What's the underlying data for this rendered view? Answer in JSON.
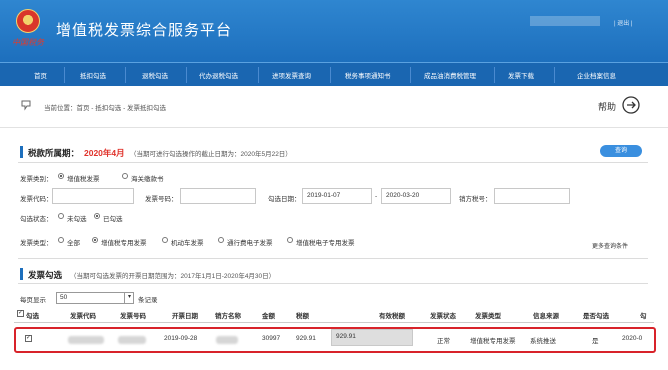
{
  "header": {
    "title": "增值税发票综合服务平台",
    "emblem_text": "中国税务",
    "exit_label": "| 退出 |"
  },
  "nav": {
    "items": [
      "首页",
      "抵扣勾选",
      "退税勾选",
      "代办退税勾选",
      "进项发票查询",
      "税务事项通知书",
      "成品油消费税管理",
      "发票下载",
      "企业档案信息"
    ]
  },
  "breadcrumb": {
    "text": "当前位置：首页 - 抵扣勾选 - 发票抵扣勾选",
    "help_label": "帮助"
  },
  "period": {
    "label": "税款所属期：",
    "value": "2020年4月",
    "note": "（当期可进行勾选操作的截止日期为：2020年5月22日）",
    "query_button": "查询"
  },
  "filters": {
    "invoice_class_label": "发票类别：",
    "invoice_class_options": [
      "增值税发票",
      "海关缴款书"
    ],
    "invoice_code_label": "发票代码：",
    "invoice_number_label": "发票号码：",
    "date_label": "勾选日期：",
    "date_from": "2019-01-07",
    "date_sep": "-",
    "date_to": "2020-03-20",
    "seller_tax_label": "销方税号：",
    "check_status_label": "勾选状态：",
    "check_status_options": [
      "未勾选",
      "已勾选"
    ],
    "invoice_type_label": "发票类型：",
    "invoice_type_options": [
      "全部",
      "增值税专用发票",
      "机动车发票",
      "通行费电子发票",
      "增值税电子专用发票"
    ],
    "more_conditions": "更多查询条件"
  },
  "invoice_section": {
    "title": "发票勾选",
    "note": "（当期可勾选发票的开票日期范围为：2017年1月1日-2020年4月30日）",
    "page_size_label": "每页显示",
    "page_size_value": "50",
    "page_size_unit": "条记录"
  },
  "table": {
    "headers": [
      "勾选",
      "发票代码",
      "发票号码",
      "开票日期",
      "销方名称",
      "金额",
      "税额",
      "有效税额",
      "发票状态",
      "发票类型",
      "信息来源",
      "是否勾选",
      "勾"
    ],
    "row": {
      "date": "2019-09-28",
      "amount": "30997",
      "tax": "929.91",
      "valid_tax": "929.91",
      "status": "正常",
      "type": "增值税专用发票",
      "source": "系统推送",
      "checked": "是",
      "check_date": "2020-0"
    }
  }
}
